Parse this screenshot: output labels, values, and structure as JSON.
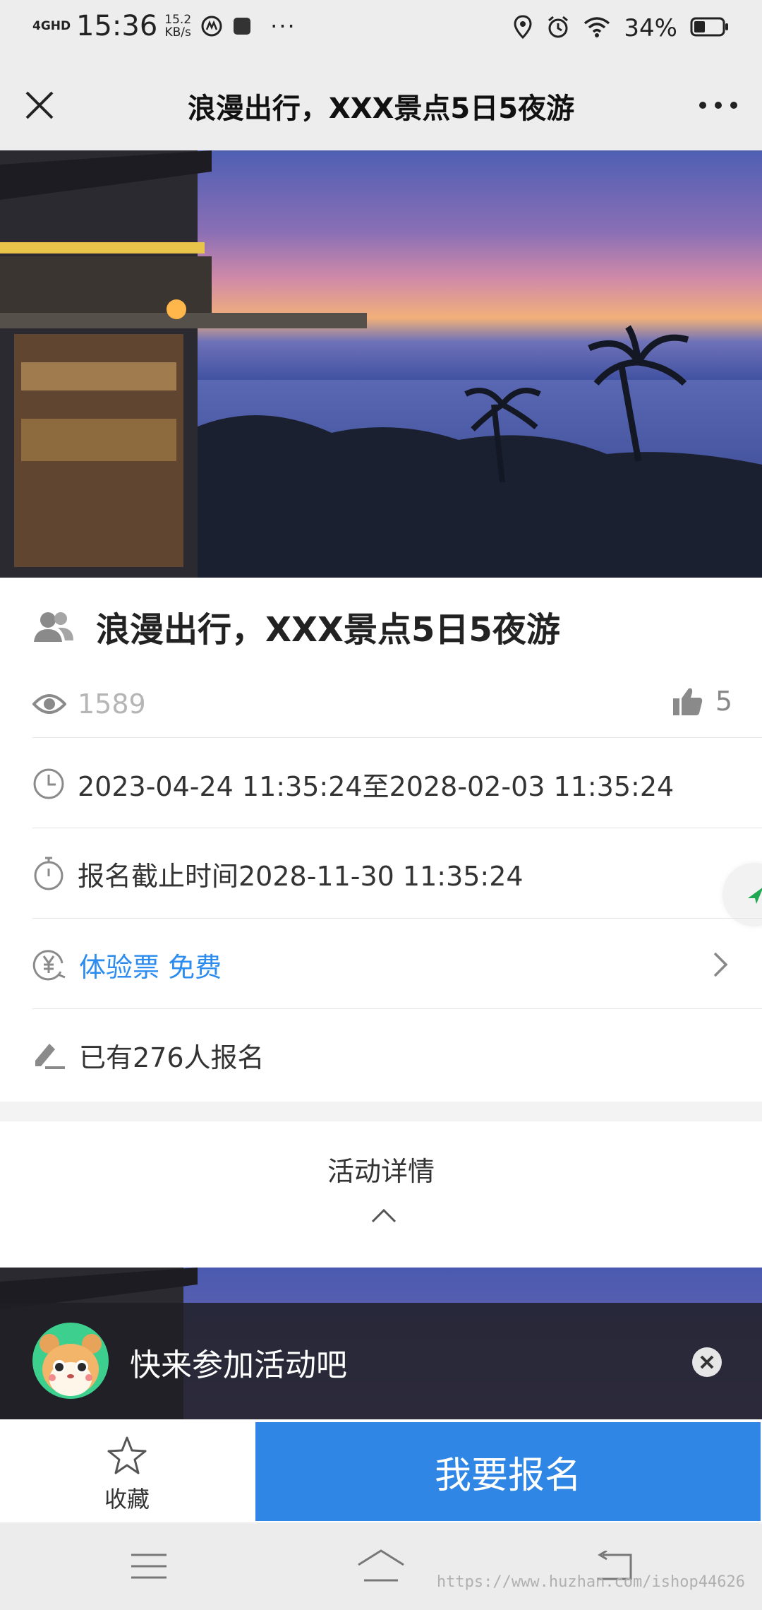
{
  "status_bar": {
    "network": "4GHD",
    "time": "15:36",
    "speed_value": "15.2",
    "speed_unit": "KB/s",
    "overflow": "···",
    "battery": "34%"
  },
  "title_bar": {
    "title": "浪漫出行，XXX景点5日5夜游"
  },
  "event": {
    "title": "浪漫出行，XXX景点5日5夜游",
    "views": "1589",
    "likes": "5",
    "time_range": "2023-04-24 11:35:24至2028-02-03 11:35:24",
    "deadline": "报名截止时间2028-11-30 11:35:24",
    "ticket_label": "体验票 免费",
    "signup_count": "已有276人报名"
  },
  "details": {
    "heading": "活动详情"
  },
  "toast": {
    "message": "快来参加活动吧"
  },
  "bottom_bar": {
    "favorite_label": "收藏",
    "signup_label": "我要报名"
  },
  "watermark": "https://www.huzhan.com/ishop44626",
  "colors": {
    "accent": "#2f86e4",
    "link": "#2d8cf0",
    "icon_grey": "#8a8a8a"
  }
}
